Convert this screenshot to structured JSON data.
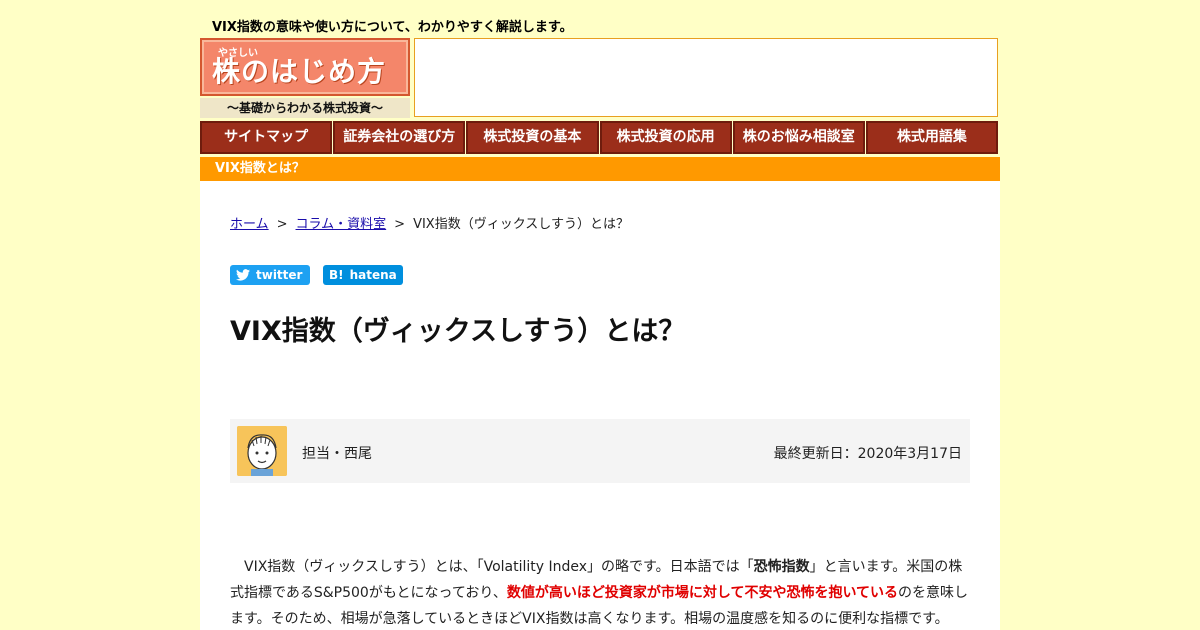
{
  "header": {
    "tagline": "VIX指数の意味や使い方について、わかりやすく解説します。",
    "logo_ruby": "やさしい",
    "logo_main": "株のはじめ方",
    "logo_sub": "～基礎からわかる株式投資～"
  },
  "nav": {
    "items": [
      "サイトマップ",
      "証券会社の選び方",
      "株式投資の基本",
      "株式投資の応用",
      "株のお悩み相談室",
      "株式用語集"
    ]
  },
  "title_bar": "VIX指数とは？",
  "breadcrumb": {
    "home": "ホーム",
    "sep1": ">",
    "column": "コラム・資料室",
    "sep2": ">",
    "current": "VIX指数（ヴィックスしすう）とは？"
  },
  "share": {
    "twitter": "twitter",
    "hatena": "hatena",
    "hatena_mark": "B!"
  },
  "page_title": "VIX指数（ヴィックスしすう）とは？",
  "author": {
    "name": "担当・西尾",
    "updated": "最終更新日：2020年3月17日"
  },
  "body": {
    "p1_a": "　VIX指数（ヴィックスしすう）とは、「Volatility Index」の略です。日本語では「",
    "p1_strong": "恐怖指数",
    "p1_b": "」と言います。米国の株式指標であるS&P500がもとになっており、",
    "p1_red": "数値が高いほど投資家が市場に対して不安や恐怖を抱いている",
    "p1_c": "のを意味します。そのため、相場が急落しているときほどVIX指数は高くなります。相場の温度感を知るのに便利な指標です。"
  },
  "colors": {
    "background": "#ffffc6",
    "nav": "#9b2e1a",
    "title_bar": "#ff9900",
    "logo": "#f4866a",
    "emphasis": "#e00000"
  }
}
